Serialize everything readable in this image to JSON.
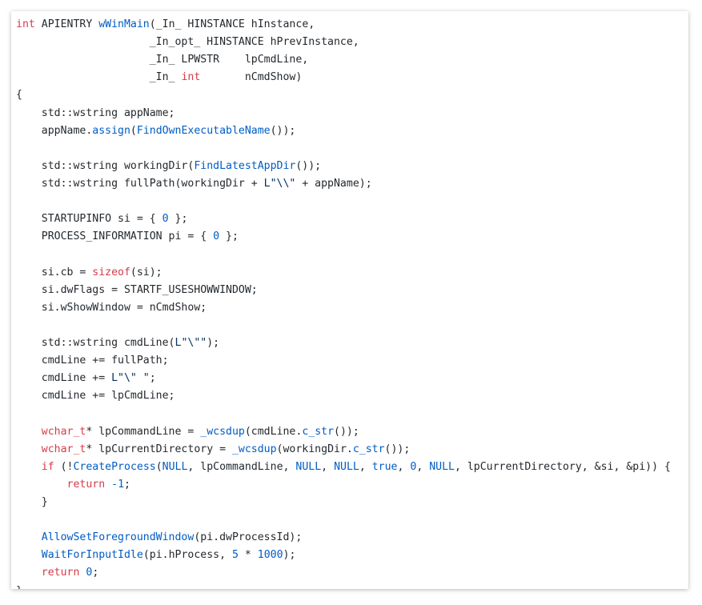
{
  "editor": {
    "language": "cpp",
    "colors": {
      "background": "#ffffff",
      "plain": "#24292e",
      "keyword": "#d73a49",
      "function": "#005cc5",
      "number": "#005cc5",
      "string": "#032f62"
    },
    "lines": [
      [
        {
          "t": "k",
          "s": "int"
        },
        {
          "t": "p",
          "s": " APIENTRY "
        },
        {
          "t": "f",
          "s": "wWinMain"
        },
        {
          "t": "p",
          "s": "(_In_ HINSTANCE hInstance,"
        }
      ],
      [
        {
          "t": "p",
          "s": "                     _In_opt_ HINSTANCE hPrevInstance,"
        }
      ],
      [
        {
          "t": "p",
          "s": "                     _In_ LPWSTR    lpCmdLine,"
        }
      ],
      [
        {
          "t": "p",
          "s": "                     _In_ "
        },
        {
          "t": "k",
          "s": "int"
        },
        {
          "t": "p",
          "s": "       nCmdShow)"
        }
      ],
      [
        {
          "t": "p",
          "s": "{"
        }
      ],
      [
        {
          "t": "p",
          "s": "    std::wstring appName;"
        }
      ],
      [
        {
          "t": "p",
          "s": "    appName."
        },
        {
          "t": "f",
          "s": "assign"
        },
        {
          "t": "p",
          "s": "("
        },
        {
          "t": "f",
          "s": "FindOwnExecutableName"
        },
        {
          "t": "p",
          "s": "());"
        }
      ],
      [],
      [
        {
          "t": "p",
          "s": "    std::wstring workingDir("
        },
        {
          "t": "f",
          "s": "FindLatestAppDir"
        },
        {
          "t": "p",
          "s": "());"
        }
      ],
      [
        {
          "t": "p",
          "s": "    std::wstring fullPath(workingDir + "
        },
        {
          "t": "s",
          "s": "L\"\\\\\""
        },
        {
          "t": "p",
          "s": " + appName);"
        }
      ],
      [],
      [
        {
          "t": "p",
          "s": "    STARTUPINFO si = { "
        },
        {
          "t": "n",
          "s": "0"
        },
        {
          "t": "p",
          "s": " };"
        }
      ],
      [
        {
          "t": "p",
          "s": "    PROCESS_INFORMATION pi = { "
        },
        {
          "t": "n",
          "s": "0"
        },
        {
          "t": "p",
          "s": " };"
        }
      ],
      [],
      [
        {
          "t": "p",
          "s": "    si.cb = "
        },
        {
          "t": "k",
          "s": "sizeof"
        },
        {
          "t": "p",
          "s": "(si);"
        }
      ],
      [
        {
          "t": "p",
          "s": "    si.dwFlags = STARTF_USESHOWWINDOW;"
        }
      ],
      [
        {
          "t": "p",
          "s": "    si.wShowWindow = nCmdShow;"
        }
      ],
      [],
      [
        {
          "t": "p",
          "s": "    std::wstring cmdLine("
        },
        {
          "t": "s",
          "s": "L\"\\\"\""
        },
        {
          "t": "p",
          "s": ");"
        }
      ],
      [
        {
          "t": "p",
          "s": "    cmdLine += fullPath;"
        }
      ],
      [
        {
          "t": "p",
          "s": "    cmdLine += "
        },
        {
          "t": "s",
          "s": "L\"\\\" \""
        },
        {
          "t": "p",
          "s": ";"
        }
      ],
      [
        {
          "t": "p",
          "s": "    cmdLine += lpCmdLine;"
        }
      ],
      [],
      [
        {
          "t": "p",
          "s": "    "
        },
        {
          "t": "k",
          "s": "wchar_t"
        },
        {
          "t": "p",
          "s": "* lpCommandLine = "
        },
        {
          "t": "f",
          "s": "_wcsdup"
        },
        {
          "t": "p",
          "s": "(cmdLine."
        },
        {
          "t": "f",
          "s": "c_str"
        },
        {
          "t": "p",
          "s": "());"
        }
      ],
      [
        {
          "t": "p",
          "s": "    "
        },
        {
          "t": "k",
          "s": "wchar_t"
        },
        {
          "t": "p",
          "s": "* lpCurrentDirectory = "
        },
        {
          "t": "f",
          "s": "_wcsdup"
        },
        {
          "t": "p",
          "s": "(workingDir."
        },
        {
          "t": "f",
          "s": "c_str"
        },
        {
          "t": "p",
          "s": "());"
        }
      ],
      [
        {
          "t": "p",
          "s": "    "
        },
        {
          "t": "k",
          "s": "if"
        },
        {
          "t": "p",
          "s": " (!"
        },
        {
          "t": "f",
          "s": "CreateProcess"
        },
        {
          "t": "p",
          "s": "("
        },
        {
          "t": "n",
          "s": "NULL"
        },
        {
          "t": "p",
          "s": ", lpCommandLine, "
        },
        {
          "t": "n",
          "s": "NULL"
        },
        {
          "t": "p",
          "s": ", "
        },
        {
          "t": "n",
          "s": "NULL"
        },
        {
          "t": "p",
          "s": ", "
        },
        {
          "t": "n",
          "s": "true"
        },
        {
          "t": "p",
          "s": ", "
        },
        {
          "t": "n",
          "s": "0"
        },
        {
          "t": "p",
          "s": ", "
        },
        {
          "t": "n",
          "s": "NULL"
        },
        {
          "t": "p",
          "s": ", lpCurrentDirectory, &si, &pi)) {"
        }
      ],
      [
        {
          "t": "p",
          "s": "        "
        },
        {
          "t": "k",
          "s": "return"
        },
        {
          "t": "p",
          "s": " "
        },
        {
          "t": "n",
          "s": "-1"
        },
        {
          "t": "p",
          "s": ";"
        }
      ],
      [
        {
          "t": "p",
          "s": "    }"
        }
      ],
      [],
      [
        {
          "t": "p",
          "s": "    "
        },
        {
          "t": "f",
          "s": "AllowSetForegroundWindow"
        },
        {
          "t": "p",
          "s": "(pi.dwProcessId);"
        }
      ],
      [
        {
          "t": "p",
          "s": "    "
        },
        {
          "t": "f",
          "s": "WaitForInputIdle"
        },
        {
          "t": "p",
          "s": "(pi.hProcess, "
        },
        {
          "t": "n",
          "s": "5"
        },
        {
          "t": "p",
          "s": " * "
        },
        {
          "t": "n",
          "s": "1000"
        },
        {
          "t": "p",
          "s": ");"
        }
      ],
      [
        {
          "t": "p",
          "s": "    "
        },
        {
          "t": "k",
          "s": "return"
        },
        {
          "t": "p",
          "s": " "
        },
        {
          "t": "n",
          "s": "0"
        },
        {
          "t": "p",
          "s": ";"
        }
      ],
      [
        {
          "t": "p",
          "s": "}"
        }
      ]
    ]
  }
}
